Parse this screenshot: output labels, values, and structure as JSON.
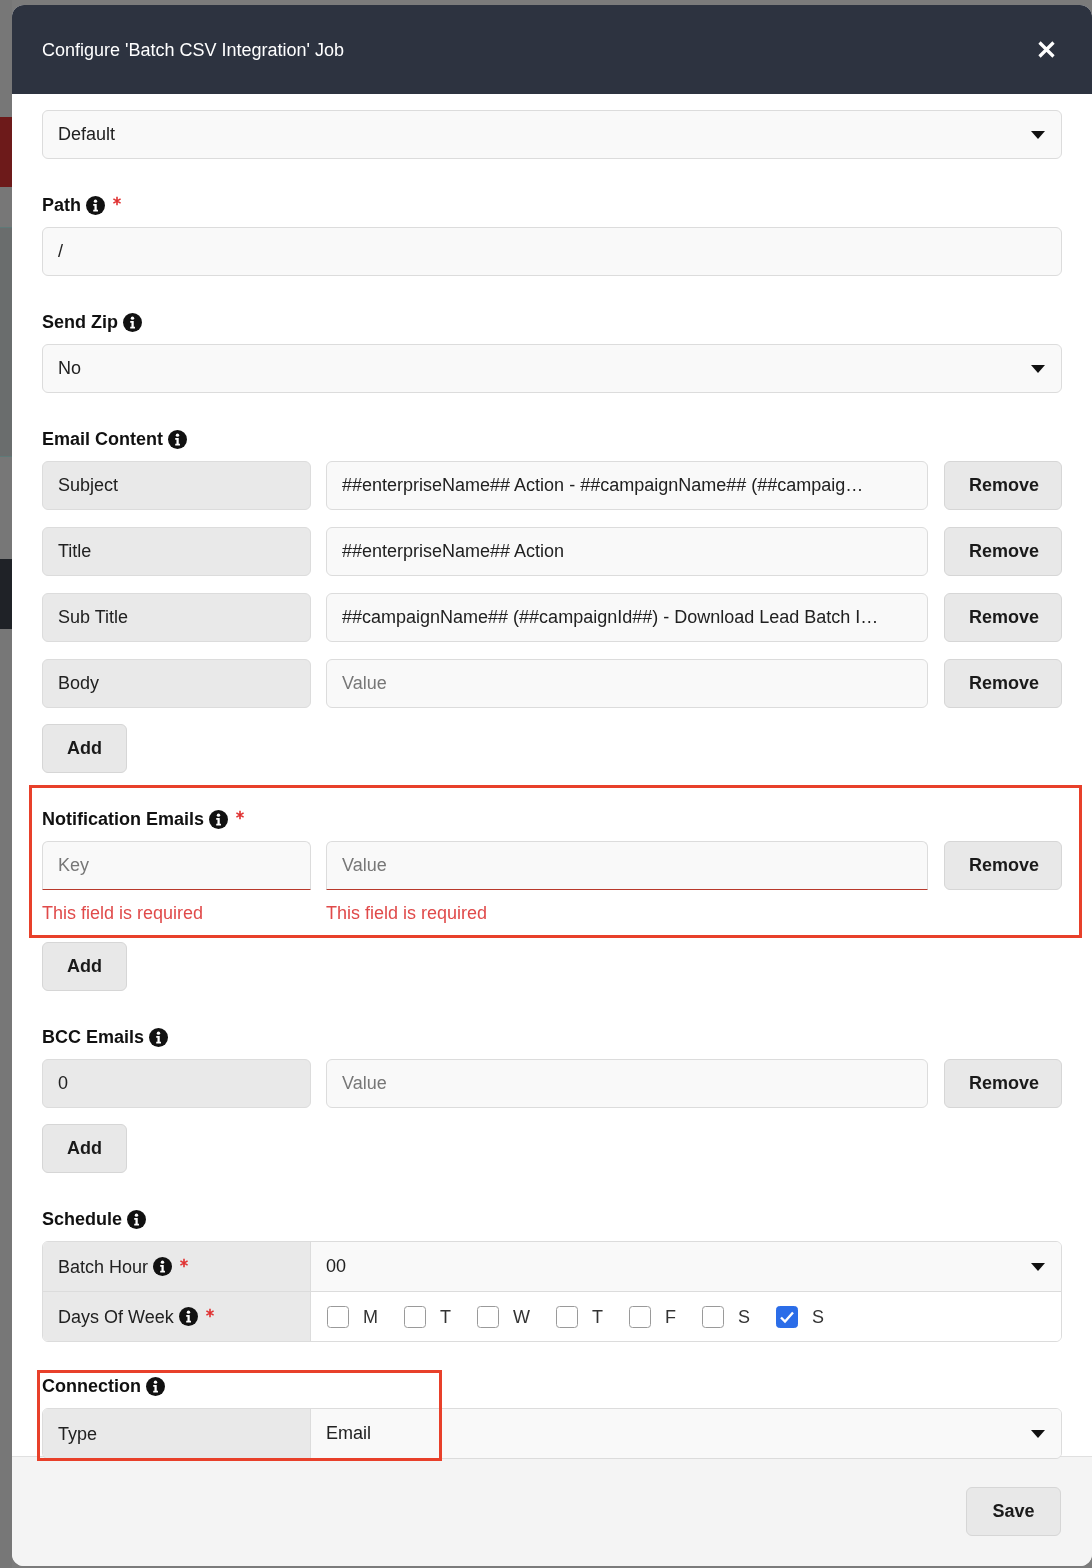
{
  "modal": {
    "title": "Configure 'Batch CSV Integration' Job"
  },
  "fields": [
    {
      "kind": "select",
      "value": "Default"
    },
    {
      "kind": "input",
      "label": "Path",
      "info": true,
      "required": true,
      "value": "/"
    },
    {
      "kind": "select",
      "label": "Send Zip",
      "info": true,
      "required": false,
      "value": "No"
    },
    {
      "kind": "keyvalue",
      "label": "Email Content",
      "info": true,
      "required": false,
      "highlighted": false,
      "rows": [
        {
          "key": {
            "value": "Subject",
            "disabled": true
          },
          "value": {
            "value": "##enterpriseName## Action - ##campaignName## (##campaig…"
          },
          "remove_button": "Remove"
        },
        {
          "key": {
            "value": "Title",
            "disabled": true
          },
          "value": {
            "value": "##enterpriseName## Action"
          },
          "remove_button": "Remove"
        },
        {
          "key": {
            "value": "Sub Title",
            "disabled": true
          },
          "value": {
            "value": "##campaignName## (##campaignId##) - Download Lead Batch I…"
          },
          "remove_button": "Remove"
        },
        {
          "key": {
            "value": "Body",
            "disabled": true
          },
          "value": {
            "placeholder": "Value"
          },
          "remove_button": "Remove"
        }
      ],
      "add_button": "Add"
    },
    {
      "kind": "keyvalue",
      "label": "Notification Emails",
      "info": true,
      "required": true,
      "highlighted": true,
      "rows": [
        {
          "key": {
            "placeholder": "Key",
            "disabled": false,
            "error": "This field is required"
          },
          "value": {
            "placeholder": "Value",
            "error": "This field is required"
          },
          "remove_button": "Remove"
        }
      ],
      "add_button": "Add"
    },
    {
      "kind": "keyvalue",
      "label": "BCC Emails",
      "info": true,
      "required": false,
      "highlighted": false,
      "rows": [
        {
          "key": {
            "value": "0",
            "disabled": true
          },
          "value": {
            "placeholder": "Value"
          },
          "remove_button": "Remove"
        }
      ],
      "add_button": "Add"
    },
    {
      "kind": "table",
      "label": "Schedule",
      "info": true,
      "required": false,
      "highlighted": false,
      "rows": [
        {
          "kind": "select",
          "label": "Batch Hour",
          "info": true,
          "required": true,
          "value": "00"
        },
        {
          "kind": "days",
          "label": "Days Of Week",
          "info": true,
          "required": true,
          "days": [
            {
              "label": "M",
              "checked": false
            },
            {
              "label": "T",
              "checked": false
            },
            {
              "label": "W",
              "checked": false
            },
            {
              "label": "T",
              "checked": false
            },
            {
              "label": "F",
              "checked": false
            },
            {
              "label": "S",
              "checked": false
            },
            {
              "label": "S",
              "checked": true
            }
          ]
        }
      ]
    },
    {
      "kind": "table",
      "label": "Connection",
      "info": true,
      "required": false,
      "highlighted": true,
      "rows": [
        {
          "kind": "select",
          "label": "Type",
          "info": false,
          "required": false,
          "value": "Email"
        }
      ]
    }
  ],
  "footer": {
    "save_button": "Save"
  }
}
